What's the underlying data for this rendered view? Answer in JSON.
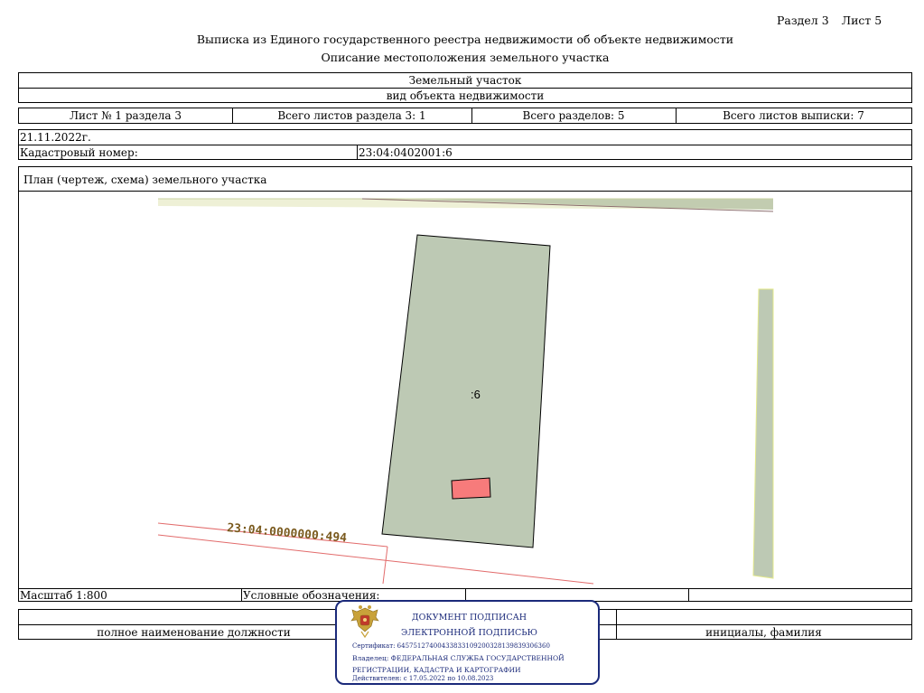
{
  "header": {
    "section_label": "Раздел 3",
    "sheet_label": "Лист 5",
    "title": "Выписка из Единого государственного реестра недвижимости об объекте недвижимости",
    "subtitle": "Описание местоположения земельного участка"
  },
  "object": {
    "type": "Земельный участок",
    "type_caption": "вид объекта недвижимости"
  },
  "counts": {
    "sheet_of_section": "Лист № 1 раздела 3",
    "total_sheets_section": "Всего листов раздела 3: 1",
    "total_sections": "Всего разделов: 5",
    "total_sheets_extract": "Всего листов выписки: 7"
  },
  "info": {
    "date": "21.11.2022г.",
    "cadastral_label": "Кадастровый номер:",
    "cadastral_number": "23:04:0402001:6"
  },
  "plan": {
    "title": "План (чертеж, схема) земельного участка",
    "parcel_label": ":6",
    "neighbor_label": "23:04:0000000:494",
    "parcel_fill": "#bdc9b4",
    "building_fill": "#f77b7b",
    "label_color": "#7a5a1e"
  },
  "footer": {
    "scale": "Масштаб 1:800",
    "legend_label": "Условные обозначения:",
    "position_caption": "полное наименование должности",
    "initials_caption": "инициалы, фамилия"
  },
  "stamp": {
    "line1": "ДОКУМЕНТ ПОДПИСАН",
    "line2": "ЭЛЕКТРОННОЙ ПОДПИСЬЮ",
    "certificate": "Сертификат: 64575127400433833109200328139839306360",
    "owner1": "Владелец: ФЕДЕРАЛЬНАЯ СЛУЖБА ГОСУДАРСТВЕННОЙ",
    "owner2": "РЕГИСТРАЦИИ, КАДАСТРА И КАРТОГРАФИИ",
    "validity": "Действителен: с 17.05.2022 по 10.08.2023",
    "color": "#1b2a7a"
  }
}
